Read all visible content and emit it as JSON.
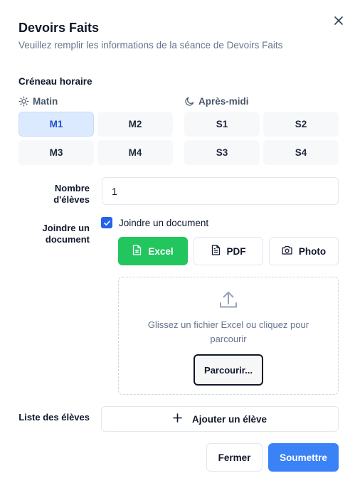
{
  "dialog": {
    "title": "Devoirs Faits",
    "subtitle": "Veuillez remplir les informations de la séance de Devoirs Faits",
    "close_icon": "close-icon"
  },
  "slots": {
    "label": "Créneau horaire",
    "morning": {
      "label": "Matin",
      "icon": "sun-icon",
      "items": [
        "M1",
        "M2",
        "M3",
        "M4"
      ],
      "selected": "M1"
    },
    "afternoon": {
      "label": "Après-midi",
      "icon": "moon-icon",
      "items": [
        "S1",
        "S2",
        "S3",
        "S4"
      ]
    }
  },
  "students_count": {
    "label_line1": "Nombre",
    "label_line2": "d'élèves",
    "value": "1"
  },
  "attachment": {
    "label_line1": "Joindre un",
    "label_line2": "document",
    "checkbox_label": "Joindre un document",
    "checked": true,
    "types": [
      {
        "label": "Excel",
        "icon": "spreadsheet-icon",
        "selected": true
      },
      {
        "label": "PDF",
        "icon": "document-icon",
        "selected": false
      },
      {
        "label": "Photo",
        "icon": "camera-icon",
        "selected": false
      }
    ],
    "dropzone_text": "Glissez un fichier Excel ou cliquez pour parcourir",
    "browse_label": "Parcourir...",
    "upload_icon": "upload-icon"
  },
  "students_list": {
    "label": "Liste des élèves",
    "add_label": "Ajouter un élève",
    "add_icon": "plus-icon"
  },
  "actions": {
    "cancel": "Fermer",
    "submit": "Soumettre"
  },
  "colors": {
    "primary": "#3b82f6",
    "success": "#22c55e",
    "selected_bg": "#dbeafe",
    "selected_text": "#1d4ed8"
  }
}
